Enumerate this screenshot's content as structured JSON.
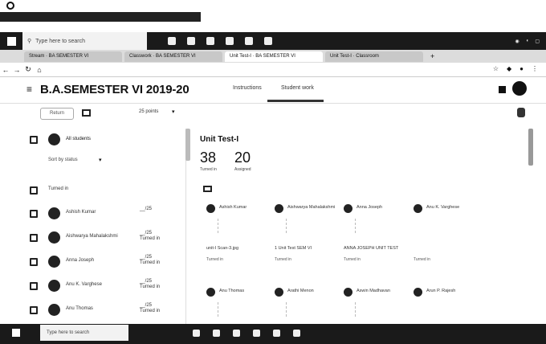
{
  "taskbar": {
    "search_placeholder": "Type here to search"
  },
  "browser": {
    "tabs": [
      {
        "label": "Stream · BA SEMESTER VI"
      },
      {
        "label": "Classwork · BA SEMESTER VI"
      },
      {
        "label": "Unit Test-I · BA SEMESTER VI"
      },
      {
        "label": "Unit Test-I · Classroom"
      }
    ],
    "new_tab": "+"
  },
  "classroom": {
    "course_title": "B.A.SEMESTER VI 2019-20",
    "tabs": [
      {
        "label": "Instructions"
      },
      {
        "label": "Student work"
      }
    ],
    "return_label": "Return",
    "points_label": "25 points",
    "all_students": "All students",
    "sort_label": "Sort by status",
    "group_label": "Turned in",
    "students": [
      {
        "name": "Ashish Kumar",
        "score": "__/25"
      },
      {
        "name": "Aishwarya Mahalakshmi",
        "score": "__/25",
        "status": "Turned in"
      },
      {
        "name": "Anna Joseph",
        "score": "__/25",
        "status": "Turned in"
      },
      {
        "name": "Anu K. Varghese",
        "score": "__/25",
        "status": "Turned in"
      },
      {
        "name": "Anu Thomas",
        "score": "__/25",
        "status": "Turned in"
      }
    ]
  },
  "assignment": {
    "title": "Unit Test-I",
    "turned_in": "38",
    "turned_in_label": "Turned in",
    "assigned": "20",
    "assigned_label": "Assigned",
    "cards": [
      {
        "name": "Ashish Kumar",
        "file": "unit-I Scan-3.jpg",
        "status": "Turned in"
      },
      {
        "name": "Aishwarya Mahalakshmi",
        "file": "1 Unit Test SEM VI",
        "status": "Turned in"
      },
      {
        "name": "Anna Joseph",
        "file": "ANNA JOSEPH UNIT TEST",
        "status": "Turned in"
      },
      {
        "name": "Anu K. Varghese",
        "file": "",
        "status": "Turned in"
      },
      {
        "name": "Anu Thomas",
        "file": "",
        "status": ""
      },
      {
        "name": "Arathi Menon",
        "file": "",
        "status": ""
      },
      {
        "name": "Aswin Madhavan",
        "file": "",
        "status": ""
      },
      {
        "name": "Arun P. Rajesh",
        "file": "",
        "status": ""
      }
    ]
  }
}
